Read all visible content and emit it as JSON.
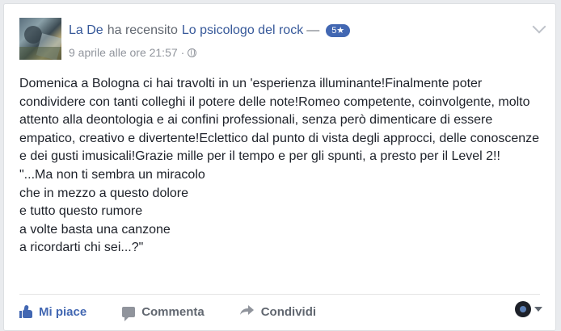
{
  "post": {
    "author": "La De",
    "action_text": "ha recensito",
    "page_name": "Lo psicologo del rock",
    "dash": "—",
    "rating": "5★",
    "timestamp": "9 aprile alle ore 21:57",
    "separator": "·",
    "privacy_icon": "globe-icon"
  },
  "body": {
    "paragraph": "Domenica a Bologna ci hai travolti in un 'esperienza illuminante!Finalmente poter condividere con tanti colleghi il potere delle note!Romeo competente, coinvolgente, molto attento alla deontologia e ai confini professionali, senza però dimenticare di essere empatico, creativo e divertente!Eclettico dal punto di vista degli approcci, delle conoscenze e dei gusti imusicali!Grazie mille per il tempo e per gli spunti, a presto per il Level 2!!",
    "quote_lines": [
      "\"...Ma non ti sembra un miracolo",
      "che in mezzo a questo dolore",
      "e tutto questo rumore",
      "a volte basta una canzone",
      "a ricordarti chi sei...?\""
    ]
  },
  "actions": {
    "like_label": "Mi piace",
    "comment_label": "Commenta",
    "share_label": "Condividi"
  },
  "colors": {
    "link": "#365899",
    "like_active": "#4267b2",
    "muted": "#90949c"
  }
}
